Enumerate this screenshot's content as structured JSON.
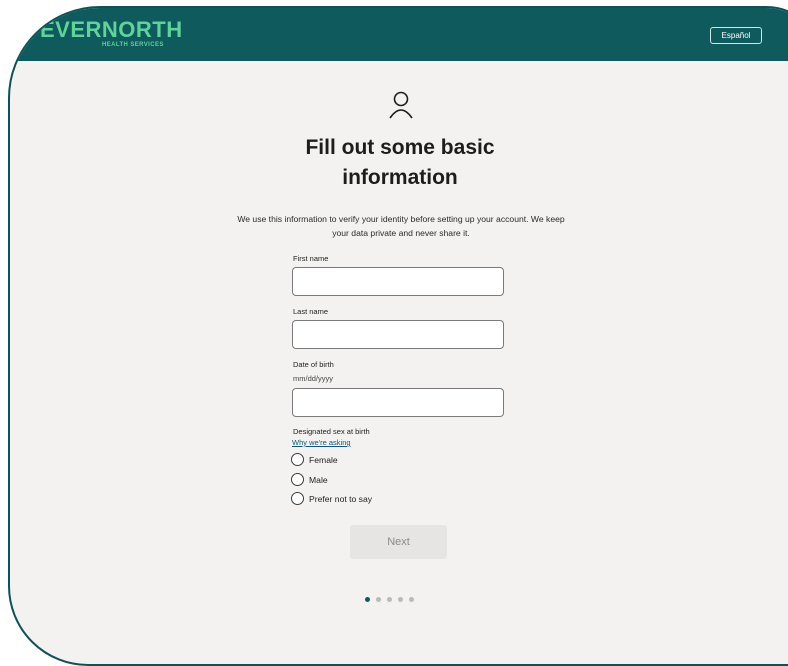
{
  "header": {
    "logo_text": "EVERNORTH",
    "logo_subtext": "HEALTH SERVICES",
    "language_button": "Español",
    "brand_color": "#0e5a5c",
    "logo_color": "#5fd39a"
  },
  "main": {
    "icon": "person-icon",
    "title_line1": "Fill out some basic",
    "title_line2": "information",
    "intro": "We use this information to verify your identity before setting up your account. We keep your data private and never share it."
  },
  "form": {
    "first_name": {
      "label": "First name",
      "value": ""
    },
    "last_name": {
      "label": "Last name",
      "value": ""
    },
    "dob": {
      "label": "Date of birth",
      "hint": "mm/dd/yyyy",
      "value": ""
    },
    "sex": {
      "label": "Designated sex at birth",
      "help_link": "Why we're asking",
      "options": [
        "Female",
        "Male",
        "Prefer not to say"
      ]
    },
    "next_button": "Next"
  },
  "progress": {
    "total_steps": 5,
    "current_step": 1
  }
}
